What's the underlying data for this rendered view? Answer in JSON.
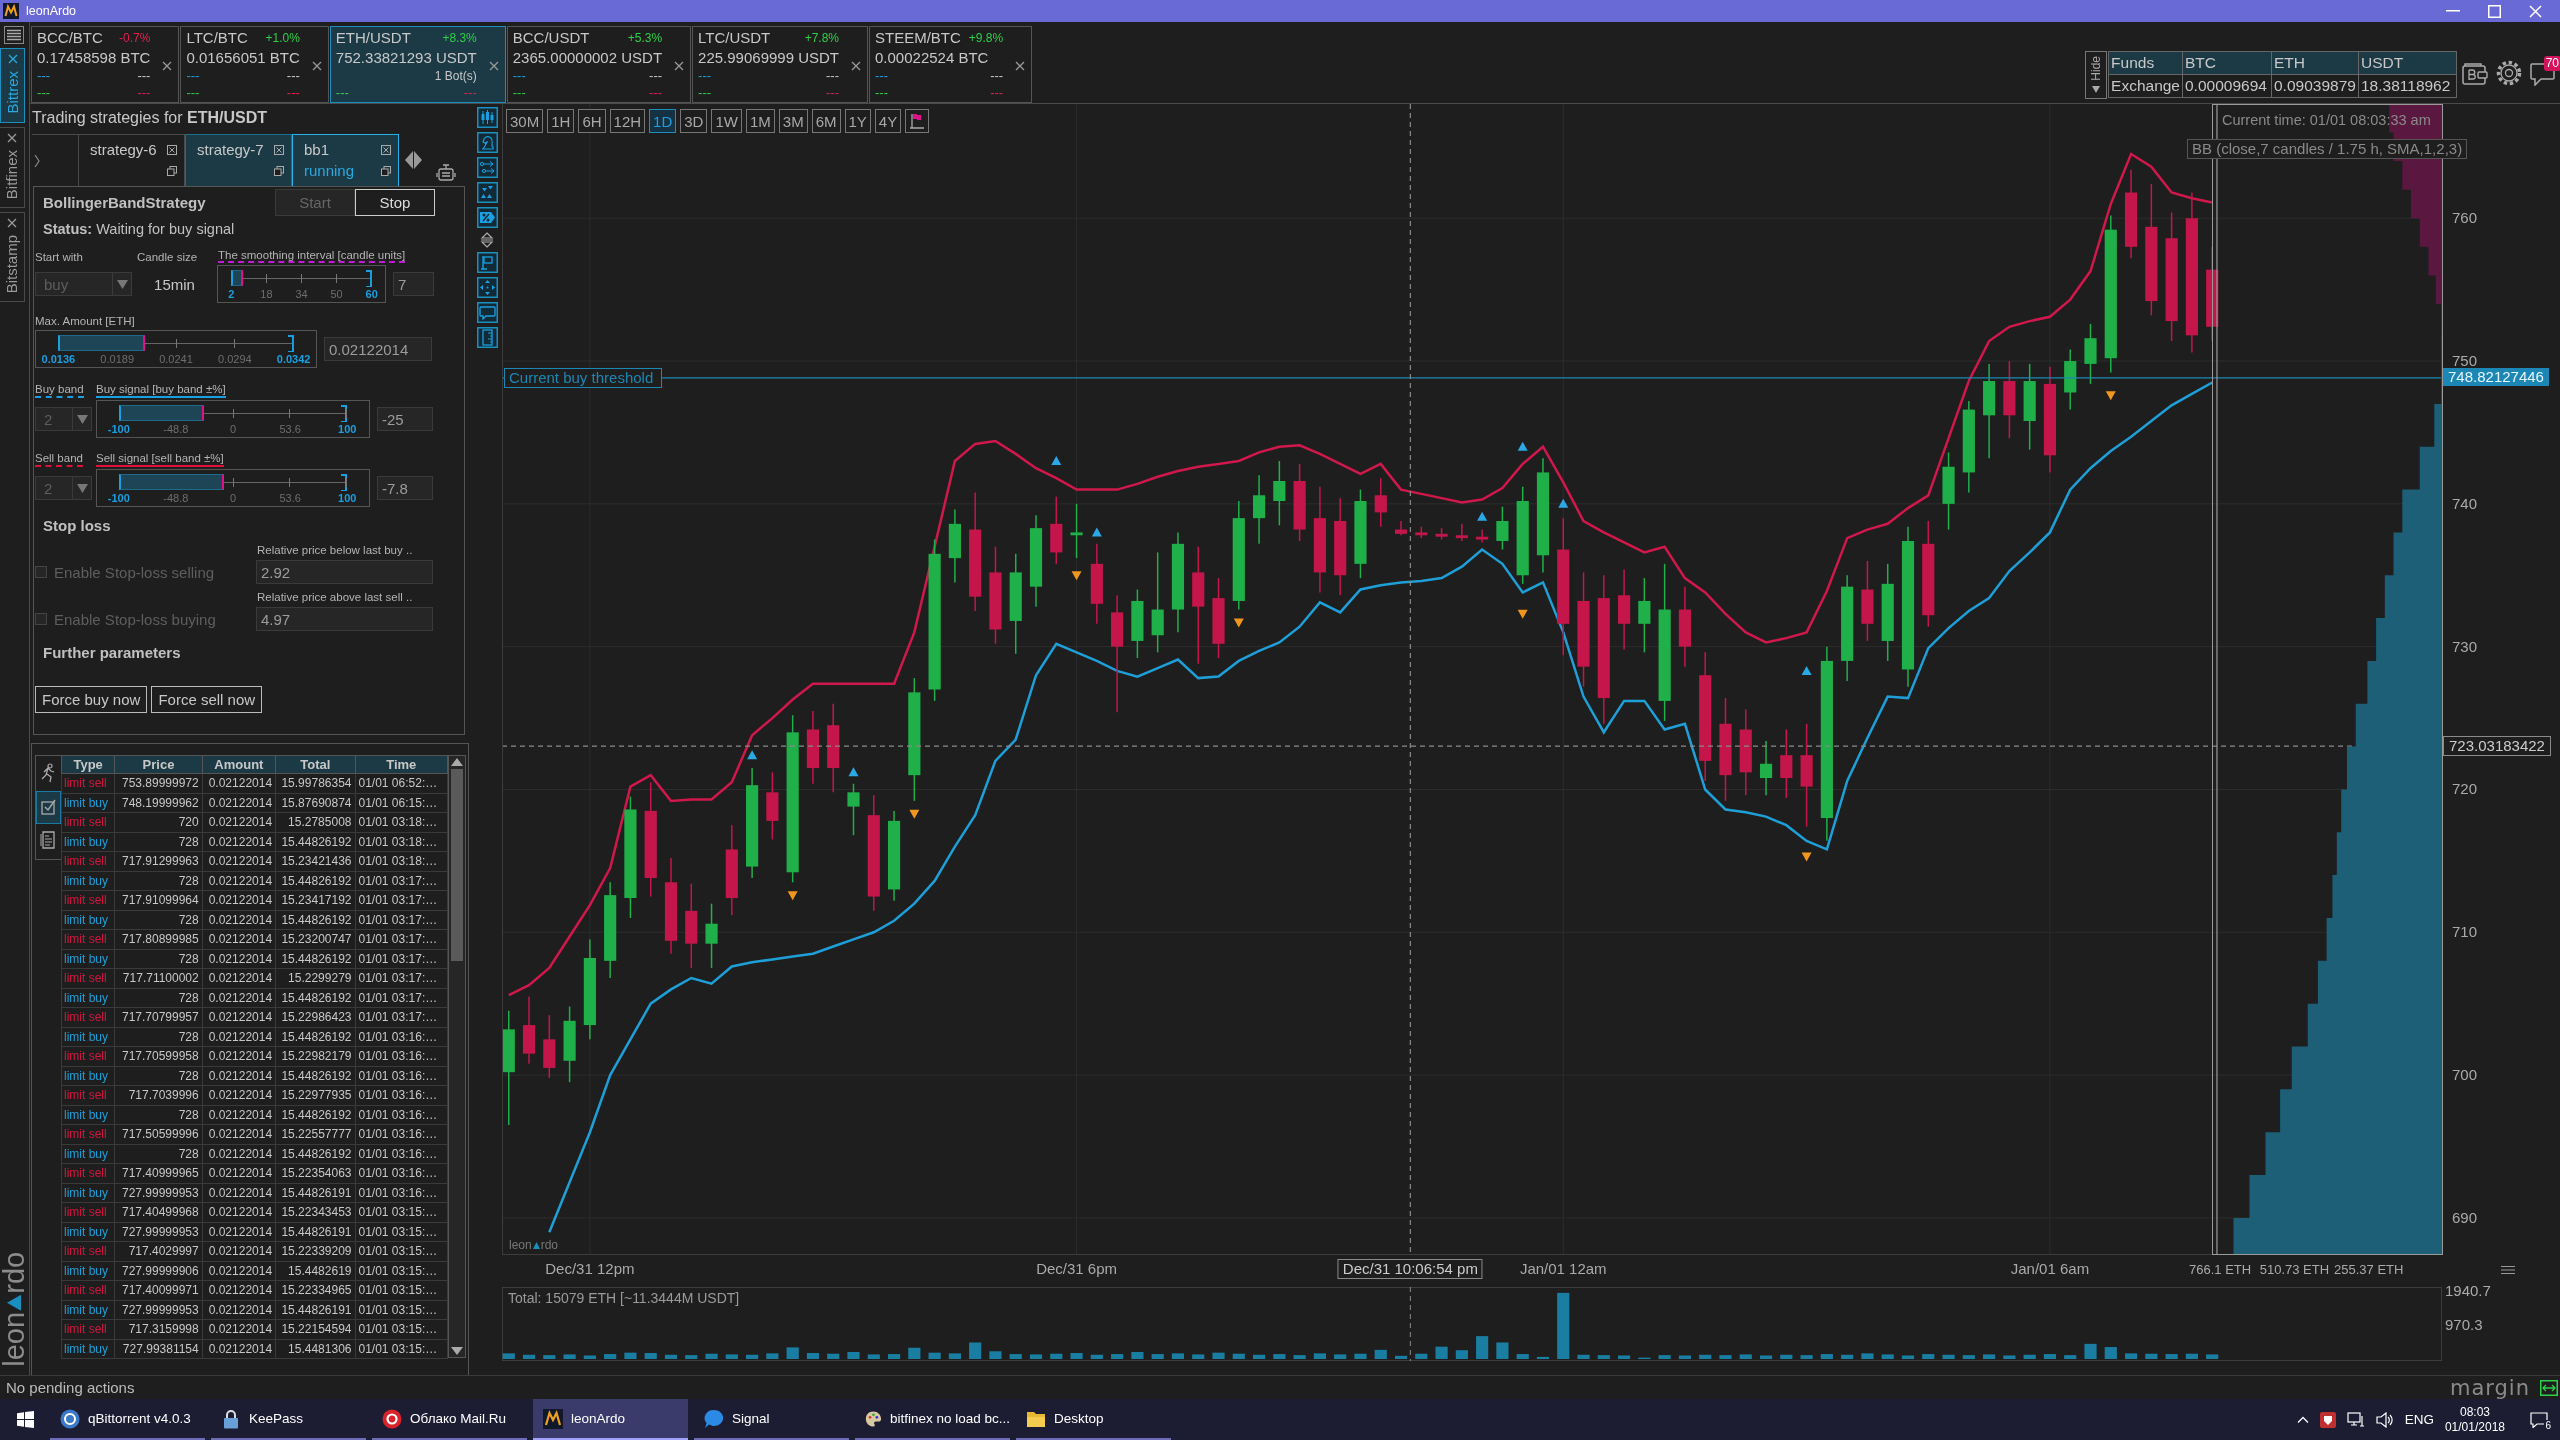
{
  "window": {
    "title": "leonArdo"
  },
  "exchanges": [
    {
      "label": "Bittrex",
      "selected": true
    },
    {
      "label": "Bitfinex",
      "selected": false
    },
    {
      "label": "Bitstamp",
      "selected": false
    }
  ],
  "logo": [
    "leon",
    "rdo"
  ],
  "tickers": [
    {
      "pair": "BCC/BTC",
      "change": "-0.7%",
      "rising": false,
      "price": "0.17458598 BTC",
      "stats_top": [
        "---",
        "---"
      ],
      "stats_bottom": [
        "---",
        "---"
      ],
      "selected": false
    },
    {
      "pair": "LTC/BTC",
      "change": "+1.0%",
      "rising": true,
      "price": "0.01656051 BTC",
      "stats_top": [
        "---",
        "---"
      ],
      "stats_bottom": [
        "---",
        "---"
      ],
      "selected": false
    },
    {
      "pair": "ETH/USDT",
      "change": "+8.3%",
      "rising": true,
      "price": "752.33821293 USDT",
      "bots": "1 Bot(s)",
      "stats_bottom": [
        "---",
        "---"
      ],
      "selected": true
    },
    {
      "pair": "BCC/USDT",
      "change": "+5.3%",
      "rising": true,
      "price": "2365.00000002 USDT",
      "stats_top": [
        "---",
        "---"
      ],
      "stats_bottom": [
        "---",
        "---"
      ],
      "selected": false
    },
    {
      "pair": "LTC/USDT",
      "change": "+7.8%",
      "rising": true,
      "price": "225.99069999 USDT",
      "stats_top": [
        "---",
        "---"
      ],
      "stats_bottom": [
        "---",
        "---"
      ],
      "selected": false
    },
    {
      "pair": "STEEM/BTC",
      "change": "+9.8%",
      "rising": true,
      "price": "0.00022524 BTC",
      "stats_top": [
        "---",
        "---"
      ],
      "stats_bottom": [
        "---",
        "---"
      ],
      "selected": false
    }
  ],
  "funds": {
    "toggle": "Hide",
    "columns": [
      "Funds",
      "BTC",
      "ETH",
      "USDT"
    ],
    "rows": [
      [
        "Exchange",
        "0.00009694",
        "0.09039879",
        "18.38118962"
      ]
    ],
    "notifications": "70"
  },
  "strategies": {
    "title": "Trading strategies for **ETH/USDT**",
    "tabs": [
      {
        "label": "strategy-6",
        "highlighted": false,
        "selected": false
      },
      {
        "label": "strategy-7",
        "highlighted": true,
        "selected": false
      },
      {
        "label": "bb1",
        "status": "running",
        "highlighted": true,
        "selected": true
      }
    ]
  },
  "strategy": {
    "name": "BollingerBandStrategy",
    "controls": [
      {
        "label": "Start",
        "disabled": true
      },
      {
        "label": "Stop",
        "disabled": false
      }
    ],
    "status": "**Status:** Waiting for buy signal",
    "start_with": {
      "label": "Start with",
      "value": "buy",
      "disabled": true
    },
    "candle_size": {
      "label": "Candle size",
      "value": "15min"
    },
    "smoothing": {
      "label": "The smoothing interval [candle units]",
      "ticks": [
        "2",
        "18",
        "34",
        "50",
        "60"
      ],
      "level": 0.086,
      "value": "7"
    },
    "max_amount": {
      "label": "Max. Amount [ETH]",
      "ticks": [
        "0.0136",
        "0.0189",
        "0.0241",
        "0.0294",
        "0.0342"
      ],
      "level": 0.37,
      "value": "0.02122014"
    },
    "bands": [
      {
        "kind": "buy",
        "band": {
          "label": "Buy band",
          "value": "2",
          "disabled": true
        },
        "signal_label": "Buy signal [buy band ±%]",
        "ticks": [
          "-100",
          "-48.8",
          "0",
          "53.6",
          "100"
        ],
        "level": 0.375,
        "value": "-25"
      },
      {
        "kind": "sell",
        "band": {
          "label": "Sell band",
          "value": "2",
          "disabled": true
        },
        "signal_label": "Sell signal [sell band ±%]",
        "ticks": [
          "-100",
          "-48.8",
          "0",
          "53.6",
          "100"
        ],
        "level": 0.461,
        "value": "-7.8"
      }
    ],
    "stop_loss": {
      "title": "Stop loss",
      "options": [
        {
          "hint": "Relative price below last buy ..",
          "label": "Enable Stop-loss selling",
          "checked": false,
          "disabled": true,
          "value": "2.92"
        },
        {
          "hint": "Relative price above last sell ..",
          "label": "Enable Stop-loss buying",
          "checked": false,
          "disabled": true,
          "value": "4.97"
        }
      ]
    },
    "further": "Further parameters",
    "actions": [
      "Force buy now",
      "Force sell now"
    ]
  },
  "trades": {
    "view_tabs": [
      {
        "selected": false
      },
      {
        "selected": true
      },
      {
        "selected": false
      }
    ],
    "columns": [
      "Type",
      "Price",
      "Amount",
      "Total",
      "Time"
    ],
    "rows": [
      {
        "kind": "sell",
        "cells": [
          "limit sell",
          "753.89999972",
          "0.02122014",
          "15.99786354",
          "01/01 06:52:…"
        ]
      },
      {
        "kind": "buy",
        "cells": [
          "limit buy",
          "748.19999962",
          "0.02122014",
          "15.87690874",
          "01/01 06:15:…"
        ]
      },
      {
        "kind": "sell",
        "cells": [
          "limit sell",
          "720",
          "0.02122014",
          "15.2785008",
          "01/01 03:18:…"
        ]
      },
      {
        "kind": "buy",
        "cells": [
          "limit buy",
          "728",
          "0.02122014",
          "15.44826192",
          "01/01 03:18:…"
        ]
      },
      {
        "kind": "sell",
        "cells": [
          "limit sell",
          "717.91299963",
          "0.02122014",
          "15.23421436",
          "01/01 03:18:…"
        ]
      },
      {
        "kind": "buy",
        "cells": [
          "limit buy",
          "728",
          "0.02122014",
          "15.44826192",
          "01/01 03:17:…"
        ]
      },
      {
        "kind": "sell",
        "cells": [
          "limit sell",
          "717.91099964",
          "0.02122014",
          "15.23417192",
          "01/01 03:17:…"
        ]
      },
      {
        "kind": "buy",
        "cells": [
          "limit buy",
          "728",
          "0.02122014",
          "15.44826192",
          "01/01 03:17:…"
        ]
      },
      {
        "kind": "sell",
        "cells": [
          "limit sell",
          "717.80899985",
          "0.02122014",
          "15.23200747",
          "01/01 03:17:…"
        ]
      },
      {
        "kind": "buy",
        "cells": [
          "limit buy",
          "728",
          "0.02122014",
          "15.44826192",
          "01/01 03:17:…"
        ]
      },
      {
        "kind": "sell",
        "cells": [
          "limit sell",
          "717.71100002",
          "0.02122014",
          "15.2299279",
          "01/01 03:17:…"
        ]
      },
      {
        "kind": "buy",
        "cells": [
          "limit buy",
          "728",
          "0.02122014",
          "15.44826192",
          "01/01 03:17:…"
        ]
      },
      {
        "kind": "sell",
        "cells": [
          "limit sell",
          "717.70799957",
          "0.02122014",
          "15.22986423",
          "01/01 03:17:…"
        ]
      },
      {
        "kind": "buy",
        "cells": [
          "limit buy",
          "728",
          "0.02122014",
          "15.44826192",
          "01/01 03:16:…"
        ]
      },
      {
        "kind": "sell",
        "cells": [
          "limit sell",
          "717.70599958",
          "0.02122014",
          "15.22982179",
          "01/01 03:16:…"
        ]
      },
      {
        "kind": "buy",
        "cells": [
          "limit buy",
          "728",
          "0.02122014",
          "15.44826192",
          "01/01 03:16:…"
        ]
      },
      {
        "kind": "sell",
        "cells": [
          "limit sell",
          "717.7039996",
          "0.02122014",
          "15.22977935",
          "01/01 03:16:…"
        ]
      },
      {
        "kind": "buy",
        "cells": [
          "limit buy",
          "728",
          "0.02122014",
          "15.44826192",
          "01/01 03:16:…"
        ]
      },
      {
        "kind": "sell",
        "cells": [
          "limit sell",
          "717.50599996",
          "0.02122014",
          "15.22557777",
          "01/01 03:16:…"
        ]
      },
      {
        "kind": "buy",
        "cells": [
          "limit buy",
          "728",
          "0.02122014",
          "15.44826192",
          "01/01 03:16:…"
        ]
      },
      {
        "kind": "sell",
        "cells": [
          "limit sell",
          "717.40999965",
          "0.02122014",
          "15.22354063",
          "01/01 03:16:…"
        ]
      },
      {
        "kind": "buy",
        "cells": [
          "limit buy",
          "727.99999953",
          "0.02122014",
          "15.44826191",
          "01/01 03:16:…"
        ]
      },
      {
        "kind": "sell",
        "cells": [
          "limit sell",
          "717.40499968",
          "0.02122014",
          "15.22343453",
          "01/01 03:15:…"
        ]
      },
      {
        "kind": "buy",
        "cells": [
          "limit buy",
          "727.99999953",
          "0.02122014",
          "15.44826191",
          "01/01 03:15:…"
        ]
      },
      {
        "kind": "sell",
        "cells": [
          "limit sell",
          "717.4029997",
          "0.02122014",
          "15.22339209",
          "01/01 03:15:…"
        ]
      },
      {
        "kind": "buy",
        "cells": [
          "limit buy",
          "727.99999906",
          "0.02122014",
          "15.4482619",
          "01/01 03:15:…"
        ]
      },
      {
        "kind": "sell",
        "cells": [
          "limit sell",
          "717.40099971",
          "0.02122014",
          "15.22334965",
          "01/01 03:15:…"
        ]
      },
      {
        "kind": "buy",
        "cells": [
          "limit buy",
          "727.99999953",
          "0.02122014",
          "15.44826191",
          "01/01 03:15:…"
        ]
      },
      {
        "kind": "sell",
        "cells": [
          "limit sell",
          "717.3159998",
          "0.02122014",
          "15.22154594",
          "01/01 03:15:…"
        ]
      },
      {
        "kind": "buy",
        "cells": [
          "limit buy",
          "727.99381154",
          "0.02122014",
          "15.4481306",
          "01/01 03:15:…"
        ]
      }
    ]
  },
  "chart": {
    "timeframes": [
      {
        "label": "30M",
        "selected": false
      },
      {
        "label": "1H",
        "selected": false
      },
      {
        "label": "6H",
        "selected": false
      },
      {
        "label": "12H",
        "selected": false
      },
      {
        "label": "1D",
        "selected": true
      },
      {
        "label": "3D",
        "selected": false
      },
      {
        "label": "1W",
        "selected": false
      },
      {
        "label": "1M",
        "selected": false
      },
      {
        "label": "3M",
        "selected": false
      },
      {
        "label": "6M",
        "selected": false
      },
      {
        "label": "1Y",
        "selected": false
      },
      {
        "label": "4Y",
        "selected": false
      }
    ],
    "indicator_label": "BB (close,7 candles / 1.75 h, SMA,1,2,3)",
    "logo": [
      "leon",
      "rdo"
    ],
    "chart_data": [
      {
        "type": "candlestick",
        "grid": true,
        "x": [
          "2017-12-31T11:00",
          "2017-12-31T11:15",
          "2017-12-31T11:30",
          "2017-12-31T11:45",
          "2017-12-31T12:00",
          "2017-12-31T12:15",
          "2017-12-31T12:30",
          "2017-12-31T12:45",
          "2017-12-31T13:00",
          "2017-12-31T13:15",
          "2017-12-31T13:30",
          "2017-12-31T13:45",
          "2017-12-31T14:00",
          "2017-12-31T14:15",
          "2017-12-31T14:30",
          "2017-12-31T14:45",
          "2017-12-31T15:00",
          "2017-12-31T15:15",
          "2017-12-31T15:30",
          "2017-12-31T15:45",
          "2017-12-31T16:00",
          "2017-12-31T16:15",
          "2017-12-31T16:30",
          "2017-12-31T16:45",
          "2017-12-31T17:00",
          "2017-12-31T17:15",
          "2017-12-31T17:30",
          "2017-12-31T17:45",
          "2017-12-31T18:00",
          "2017-12-31T18:15",
          "2017-12-31T18:30",
          "2017-12-31T18:45",
          "2017-12-31T19:00",
          "2017-12-31T19:15",
          "2017-12-31T19:30",
          "2017-12-31T19:45",
          "2017-12-31T20:00",
          "2017-12-31T20:15",
          "2017-12-31T20:30",
          "2017-12-31T20:45",
          "2017-12-31T21:00",
          "2017-12-31T21:15",
          "2017-12-31T21:30",
          "2017-12-31T21:45",
          "2017-12-31T22:00",
          "2017-12-31T22:15",
          "2017-12-31T22:30",
          "2017-12-31T22:45",
          "2017-12-31T23:00",
          "2017-12-31T23:15",
          "2017-12-31T23:30",
          "2017-12-31T23:45",
          "2018-01-01T00:00",
          "2018-01-01T00:15",
          "2018-01-01T00:30",
          "2018-01-01T00:45",
          "2018-01-01T01:00",
          "2018-01-01T01:15",
          "2018-01-01T01:30",
          "2018-01-01T01:45",
          "2018-01-01T02:00",
          "2018-01-01T02:15",
          "2018-01-01T02:30",
          "2018-01-01T02:45",
          "2018-01-01T03:00",
          "2018-01-01T03:15",
          "2018-01-01T03:30",
          "2018-01-01T03:45",
          "2018-01-01T04:00",
          "2018-01-01T04:15",
          "2018-01-01T04:30",
          "2018-01-01T04:45",
          "2018-01-01T05:00",
          "2018-01-01T05:15",
          "2018-01-01T05:30",
          "2018-01-01T05:45",
          "2018-01-01T06:00",
          "2018-01-01T06:15",
          "2018-01-01T06:30",
          "2018-01-01T06:45",
          "2018-01-01T07:00",
          "2018-01-01T07:15",
          "2018-01-01T07:30",
          "2018-01-01T07:45",
          "2018-01-01T08:00"
        ],
        "ohlc": [
          [
            700.2,
            704.5,
            696.5,
            703.2
          ],
          [
            703.5,
            705.5,
            700.8,
            701.5
          ],
          [
            702.5,
            704.2,
            699.8,
            700.5
          ],
          [
            701,
            704.8,
            699.5,
            703.8
          ],
          [
            703.5,
            709.5,
            702.5,
            708.2
          ],
          [
            708,
            713.5,
            706.8,
            712.6
          ],
          [
            712.4,
            719.5,
            711,
            718.6
          ],
          [
            718.5,
            720.5,
            712.5,
            713.8
          ],
          [
            713.5,
            715.2,
            708.5,
            709.4
          ],
          [
            711.5,
            713.4,
            707.5,
            709.2
          ],
          [
            709.2,
            712,
            707.5,
            710.6
          ],
          [
            715.8,
            717.5,
            711.2,
            712.4
          ],
          [
            714.6,
            721.5,
            713.8,
            720.3
          ],
          [
            719.8,
            721.2,
            716.5,
            717.8
          ],
          [
            714.2,
            725.2,
            713.5,
            724
          ],
          [
            724.2,
            725.5,
            720.4,
            721.5
          ],
          [
            724.5,
            726,
            719.8,
            721.5
          ],
          [
            718.8,
            720.4,
            716.8,
            719.8
          ],
          [
            718.2,
            719.6,
            711.5,
            712.5
          ],
          [
            713,
            718.5,
            712.2,
            717.8
          ],
          [
            721,
            727.8,
            719.2,
            726.8
          ],
          [
            727,
            737.5,
            726.2,
            736.5
          ],
          [
            736.2,
            739.6,
            734.5,
            738.6
          ],
          [
            738.2,
            740.8,
            732.5,
            733.5
          ],
          [
            735.2,
            737,
            730.2,
            731.2
          ],
          [
            731.8,
            736.5,
            729.5,
            735.2
          ],
          [
            734.2,
            739.2,
            732.8,
            738.3
          ],
          [
            738.6,
            740.5,
            735.8,
            736.6
          ],
          [
            737.8,
            740,
            736.2,
            738
          ],
          [
            735.8,
            737.2,
            731.6,
            733
          ],
          [
            732.4,
            733.6,
            725.4,
            730
          ],
          [
            730.4,
            734,
            729.2,
            733.2
          ],
          [
            730.8,
            736.6,
            729.6,
            732.6
          ],
          [
            732.6,
            738,
            731,
            737.2
          ],
          [
            735.2,
            737,
            728.8,
            732.8
          ],
          [
            733.4,
            734.8,
            729.2,
            730.2
          ],
          [
            733.2,
            740.2,
            732.6,
            739
          ],
          [
            739,
            742,
            737.2,
            740.6
          ],
          [
            740.2,
            743,
            738.5,
            741.6
          ],
          [
            741.6,
            742.8,
            737.4,
            738.2
          ],
          [
            739,
            741.2,
            733.8,
            735.2
          ],
          [
            738.8,
            740.4,
            733.6,
            735
          ],
          [
            735.8,
            741,
            734.8,
            740.2
          ],
          [
            740.6,
            741.8,
            738.4,
            739.4
          ],
          [
            738.2,
            738.8,
            737.8,
            737.9
          ],
          [
            738,
            738.4,
            737.6,
            737.8
          ],
          [
            737.9,
            738.3,
            737.5,
            737.7
          ],
          [
            737.8,
            738.6,
            737.4,
            737.6
          ],
          [
            737.7,
            738.2,
            737.3,
            737.5
          ],
          [
            737.4,
            739.8,
            736.8,
            738.8
          ],
          [
            735,
            741.2,
            734.4,
            740.2
          ],
          [
            736.4,
            743.2,
            735.2,
            742.2
          ],
          [
            736.8,
            739,
            729.4,
            731.6
          ],
          [
            733.2,
            735.2,
            727.2,
            728.6
          ],
          [
            733.4,
            735,
            724.6,
            726.4
          ],
          [
            733.6,
            735.4,
            729.8,
            731.6
          ],
          [
            731.6,
            734.8,
            729.6,
            733.2
          ],
          [
            726.2,
            735.8,
            724.8,
            732.6
          ],
          [
            732.6,
            734.2,
            728.6,
            730
          ],
          [
            728,
            729.6,
            720.6,
            722
          ],
          [
            724.6,
            726.4,
            719.2,
            721
          ],
          [
            724.2,
            725.6,
            719.6,
            721.2
          ],
          [
            720.8,
            723.4,
            719.6,
            721.8
          ],
          [
            722.4,
            724.2,
            719.4,
            720.8
          ],
          [
            722.4,
            724.6,
            717.4,
            720.2
          ],
          [
            718,
            730,
            716.4,
            729
          ],
          [
            729,
            735,
            727.6,
            734.2
          ],
          [
            734,
            736,
            730.4,
            731.6
          ],
          [
            730.4,
            735.8,
            729,
            734.4
          ],
          [
            728.4,
            738.4,
            727.2,
            737.4
          ],
          [
            737.2,
            738.8,
            731.4,
            732.2
          ],
          [
            740,
            743.6,
            738.2,
            742.6
          ],
          [
            742.2,
            747.2,
            740.8,
            746.6
          ],
          [
            746.2,
            749.8,
            743.2,
            748.6
          ],
          [
            748.6,
            750,
            744.6,
            746.2
          ],
          [
            745.8,
            749.8,
            743.8,
            748.6
          ],
          [
            748.4,
            749.6,
            742.2,
            743.4
          ],
          [
            747.8,
            750.8,
            746.6,
            750
          ],
          [
            749.8,
            752.6,
            748.4,
            751.6
          ],
          [
            750.2,
            760.2,
            749.2,
            759.2
          ],
          [
            761.8,
            763.4,
            757.2,
            758
          ],
          [
            759.4,
            762.4,
            753.2,
            754.2
          ],
          [
            758.6,
            760.4,
            751.4,
            752.8
          ],
          [
            760,
            761.8,
            750.6,
            751.8
          ],
          [
            756.4,
            758,
            751.4,
            752.4
          ]
        ],
        "series": [
          {
            "type": "line",
            "color": "#d0184c",
            "values": [
              705.6,
              706.3,
              707.5,
              709.7,
              711.9,
              714.5,
              720.2,
              721,
              719.2,
              719.3,
              719.3,
              720.5,
              723.8,
              725,
              726.3,
              727.4,
              727.4,
              727.4,
              727.4,
              727.4,
              731,
              737,
              743,
              744.2,
              744.4,
              743.5,
              742.5,
              741.8,
              741,
              741,
              741,
              741.4,
              741.9,
              742.3,
              742.6,
              742.8,
              743,
              743.6,
              744,
              744.1,
              743.5,
              742.8,
              742.1,
              742.8,
              741,
              740.7,
              740.4,
              740.1,
              740.3,
              741.1,
              742.8,
              744,
              741.5,
              738.8,
              738,
              737.3,
              736.6,
              737,
              734.8,
              733.8,
              732.3,
              731,
              730.3,
              730.6,
              731,
              733.9,
              737.6,
              738.2,
              738.6,
              739.7,
              740.6,
              744.6,
              748.6,
              751.4,
              752.4,
              752.8,
              753.1,
              754.3,
              756.3,
              761,
              764.5,
              763.6,
              761.8,
              761.4,
              761.1
            ]
          },
          {
            "type": "line",
            "color": "#1e9fd8",
            "values": [
              null,
              null,
              689,
              692.5,
              696,
              700,
              702.5,
              705,
              706,
              706.8,
              706.4,
              707.6,
              707.9,
              708.1,
              708.3,
              708.5,
              709,
              709.5,
              710,
              710.8,
              712,
              713.6,
              716,
              718.2,
              722,
              723.5,
              728,
              730.2,
              729.6,
              729,
              728.3,
              727.9,
              728.5,
              729.1,
              727.8,
              727.9,
              729,
              729.7,
              730.3,
              731.4,
              733.1,
              732.4,
              734,
              734.3,
              734.5,
              734.6,
              734.8,
              735.6,
              736.8,
              735.8,
              733.8,
              734.5,
              731,
              726.5,
              724,
              726.2,
              726.2,
              724.2,
              724.6,
              720,
              718.6,
              718.4,
              718.1,
              717.5,
              716.4,
              715.8,
              720.6,
              723.6,
              726.5,
              726.4,
              729.9,
              731.3,
              732.5,
              733.4,
              735.3,
              736.6,
              738,
              741,
              742.5,
              743.7,
              744.7,
              745.8,
              746.9,
              747.7,
              748.5
            ]
          },
          {
            "type": "scatter",
            "marker": "triangle",
            "color": "#2aa9e6",
            "x": [
              "2017-12-31T14:00",
              "2017-12-31T15:15",
              "2017-12-31T17:45",
              "2017-12-31T18:15",
              "2017-12-31T23:00",
              "2017-12-31T23:30",
              "2018-01-01T00:00",
              "2018-01-01T03:00"
            ],
            "values": [
              722.4,
              721.2,
              743,
              738,
              739.1,
              744,
              740,
              728.3
            ]
          },
          {
            "type": "scatter",
            "marker": "triangle",
            "color": "#f0961e",
            "x": [
              "2017-12-31T14:30",
              "2017-12-31T16:00",
              "2017-12-31T18:00",
              "2017-12-31T20:00",
              "2017-12-31T23:30",
              "2018-01-01T03:00",
              "2018-01-01T06:45"
            ],
            "values": [
              712.6,
              718.3,
              735,
              731.7,
              732.3,
              715.3,
              747.6
            ]
          }
        ],
        "xlim": [
          "2017-12-31T10:55",
          "2018-01-01T10:50"
        ],
        "ylim": [
          687.4,
          768
        ],
        "yticks": [
          690,
          700,
          710,
          720,
          730,
          740,
          750,
          760
        ],
        "xticks": [
          {
            "value": "2017-12-31T12:00",
            "label": "Dec/31 12pm"
          },
          {
            "value": "2017-12-31T18:00",
            "label": "Dec/31 6pm"
          },
          {
            "value": "2018-01-01T00:00",
            "label": "Jan/01 12am"
          },
          {
            "value": "2018-01-01T06:00",
            "label": "Jan/01 6am"
          }
        ],
        "ref_lines": [
          {
            "axis": "y",
            "value": 748.82127446,
            "label": "Current buy threshold",
            "color": "#1c87b4",
            "line_style": "solid"
          },
          {
            "axis": "y",
            "value": 723.03183422,
            "label": "723.03183422",
            "color": "#8a8a8a",
            "line_style": "dashed"
          },
          {
            "axis": "x",
            "value": "2017-12-31T22:06:54",
            "label": "Dec/31 10:06:54 pm",
            "color": "#8a8a8a",
            "line_style": "dashed"
          },
          {
            "axis": "x",
            "value": "2018-01-01T08:03:33",
            "label": "Current time: 01/01 08:03:33 am",
            "color": "#9a9a9a",
            "line_style": "solid"
          }
        ],
        "annotations": [
          "748.82127446"
        ]
      },
      {
        "type": "area",
        "orientation": "horizontal",
        "series": [
          {
            "color": "#1d5f76",
            "x": [
              748.8,
              747,
              744,
              741,
              738,
              735,
              732,
              729,
              726,
              723,
              720,
              717,
              714,
              711,
              708,
              705,
              702,
              699,
              696,
              693,
              690,
              687.4
            ],
            "values": [
              4,
              30,
              80,
              140,
              170,
              200,
              230,
              260,
              300,
              330,
              350,
              365,
              380,
              400,
              430,
              465,
              520,
              560,
              610,
              665,
              720,
              790
            ]
          },
          {
            "color": "#5a1840",
            "x": [
              751.8,
              754,
              756,
              758,
              760,
              762,
              764,
              766,
              768
            ],
            "values": [
              6,
              25,
              50,
              80,
              110,
              140,
              170,
              185,
              200
            ]
          }
        ],
        "xlim": [
          794,
          0
        ],
        "ylim": [
          687.4,
          768
        ],
        "xticks": [
          {
            "value": 766.1,
            "label": "766.1 ETH"
          },
          {
            "value": 510.73,
            "label": "510.73 ETH"
          },
          {
            "value": 255.37,
            "label": "255.37 ETH"
          }
        ]
      },
      {
        "type": "bar",
        "title": "Total: 15079 ETH [~11.3444M USDT]",
        "color": "#1a7ea2",
        "x": [
          "2017-12-31T11:00",
          "2017-12-31T11:15",
          "2017-12-31T11:30",
          "2017-12-31T11:45",
          "2017-12-31T12:00",
          "2017-12-31T12:15",
          "2017-12-31T12:30",
          "2017-12-31T12:45",
          "2017-12-31T13:00",
          "2017-12-31T13:15",
          "2017-12-31T13:30",
          "2017-12-31T13:45",
          "2017-12-31T14:00",
          "2017-12-31T14:15",
          "2017-12-31T14:30",
          "2017-12-31T14:45",
          "2017-12-31T15:00",
          "2017-12-31T15:15",
          "2017-12-31T15:30",
          "2017-12-31T15:45",
          "2017-12-31T16:00",
          "2017-12-31T16:15",
          "2017-12-31T16:30",
          "2017-12-31T16:45",
          "2017-12-31T17:00",
          "2017-12-31T17:15",
          "2017-12-31T17:30",
          "2017-12-31T17:45",
          "2017-12-31T18:00",
          "2017-12-31T18:15",
          "2017-12-31T18:30",
          "2017-12-31T18:45",
          "2017-12-31T19:00",
          "2017-12-31T19:15",
          "2017-12-31T19:30",
          "2017-12-31T19:45",
          "2017-12-31T20:00",
          "2017-12-31T20:15",
          "2017-12-31T20:30",
          "2017-12-31T20:45",
          "2017-12-31T21:00",
          "2017-12-31T21:15",
          "2017-12-31T21:30",
          "2017-12-31T21:45",
          "2017-12-31T22:00",
          "2017-12-31T22:15",
          "2017-12-31T22:30",
          "2017-12-31T22:45",
          "2017-12-31T23:00",
          "2017-12-31T23:15",
          "2017-12-31T23:30",
          "2017-12-31T23:45",
          "2018-01-01T00:00",
          "2018-01-01T00:15",
          "2018-01-01T00:30",
          "2018-01-01T00:45",
          "2018-01-01T01:00",
          "2018-01-01T01:15",
          "2018-01-01T01:30",
          "2018-01-01T01:45",
          "2018-01-01T02:00",
          "2018-01-01T02:15",
          "2018-01-01T02:30",
          "2018-01-01T02:45",
          "2018-01-01T03:00",
          "2018-01-01T03:15",
          "2018-01-01T03:30",
          "2018-01-01T03:45",
          "2018-01-01T04:00",
          "2018-01-01T04:15",
          "2018-01-01T04:30",
          "2018-01-01T04:45",
          "2018-01-01T05:00",
          "2018-01-01T05:15",
          "2018-01-01T05:30",
          "2018-01-01T05:45",
          "2018-01-01T06:00",
          "2018-01-01T06:15",
          "2018-01-01T06:30",
          "2018-01-01T06:45",
          "2018-01-01T07:00",
          "2018-01-01T07:15",
          "2018-01-01T07:30",
          "2018-01-01T07:45",
          "2018-01-01T08:00"
        ],
        "values": [
          160,
          120,
          110,
          130,
          100,
          140,
          180,
          170,
          120,
          110,
          150,
          130,
          120,
          160,
          330,
          170,
          150,
          200,
          130,
          140,
          320,
          180,
          160,
          470,
          220,
          140,
          130,
          150,
          170,
          120,
          140,
          200,
          140,
          160,
          130,
          180,
          150,
          120,
          140,
          110,
          160,
          130,
          150,
          260,
          90,
          150,
          350,
          250,
          650,
          470,
          140,
          60,
          1880,
          120,
          110,
          100,
          40,
          110,
          100,
          120,
          110,
          130,
          100,
          120,
          110,
          140,
          120,
          160,
          130,
          100,
          140,
          120,
          110,
          130,
          100,
          120,
          140,
          110,
          430,
          340,
          160,
          150,
          140,
          150,
          130
        ],
        "xlim": [
          "2017-12-31T10:55",
          "2018-01-01T10:50"
        ],
        "ylim": [
          0,
          1990
        ],
        "yticks": [
          970.3,
          1940.7
        ],
        "ref_lines": [
          {
            "axis": "x",
            "value": "2017-12-31T22:06:54",
            "color": "#8a8a8a",
            "line_style": "dashed"
          }
        ]
      }
    ]
  },
  "status_bar": {
    "text": "No pending actions",
    "brand": "margin"
  },
  "taskbar": {
    "items": [
      {
        "label": "qBittorrent v4.0.3",
        "selected": false
      },
      {
        "label": "KeePass",
        "selected": false
      },
      {
        "label": "Облако Mail.Ru",
        "selected": false
      },
      {
        "label": "leonArdo",
        "selected": true
      },
      {
        "label": "Signal",
        "selected": false
      },
      {
        "label": "bitfinex no load bc...",
        "selected": false
      },
      {
        "label": "Desktop",
        "selected": false
      }
    ],
    "language": "ENG",
    "time": "08:03",
    "date": "01/01/2018",
    "notifications": "6"
  }
}
